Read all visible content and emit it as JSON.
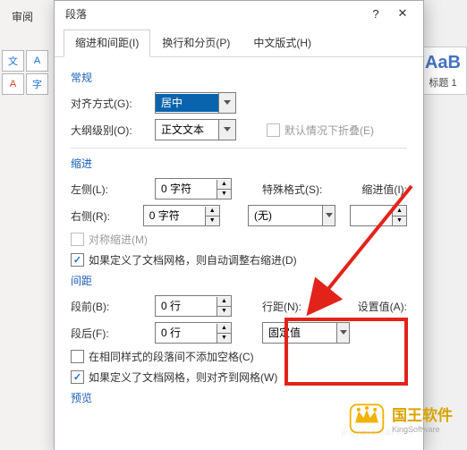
{
  "ribbon": {
    "tab_review": "审阅",
    "btn_A": "A",
    "btn_zi": "字",
    "style_preview": "AaB",
    "style_caption": "标题 1"
  },
  "dialog": {
    "title": "段落",
    "help": "?",
    "close": "✕",
    "tabs": {
      "t1": "缩进和间距(I)",
      "t2": "换行和分页(P)",
      "t3": "中文版式(H)"
    },
    "general": {
      "head": "常规",
      "align_label": "对齐方式(G):",
      "align_value": "居中",
      "outline_label": "大纲级别(O):",
      "outline_value": "正文文本",
      "collapse_label": "默认情况下折叠(E)"
    },
    "indent": {
      "head": "缩进",
      "left_label": "左侧(L):",
      "left_value": "0 字符",
      "right_label": "右侧(R):",
      "right_value": "0 字符",
      "special_label": "特殊格式(S):",
      "special_value": "(无)",
      "indent_val_label": "缩进值(I):",
      "indent_val_value": "",
      "sym_label": "对称缩进(M)",
      "grid_label": "如果定义了文档网格，则自动调整右缩进(D)"
    },
    "spacing": {
      "head": "间距",
      "before_label": "段前(B):",
      "before_value": "0 行",
      "after_label": "段后(F):",
      "after_value": "0 行",
      "line_label": "行距(N):",
      "line_value": "固定值",
      "setat_label": "设置值(A):",
      "nostyle_label": "在相同样式的段落间不添加空格(C)",
      "grid2_label": "如果定义了文档网格，则对齐到网格(W)"
    },
    "preview": {
      "head": "预览"
    }
  },
  "logo": {
    "title": "国王软件",
    "sub": "KingSoftware"
  }
}
